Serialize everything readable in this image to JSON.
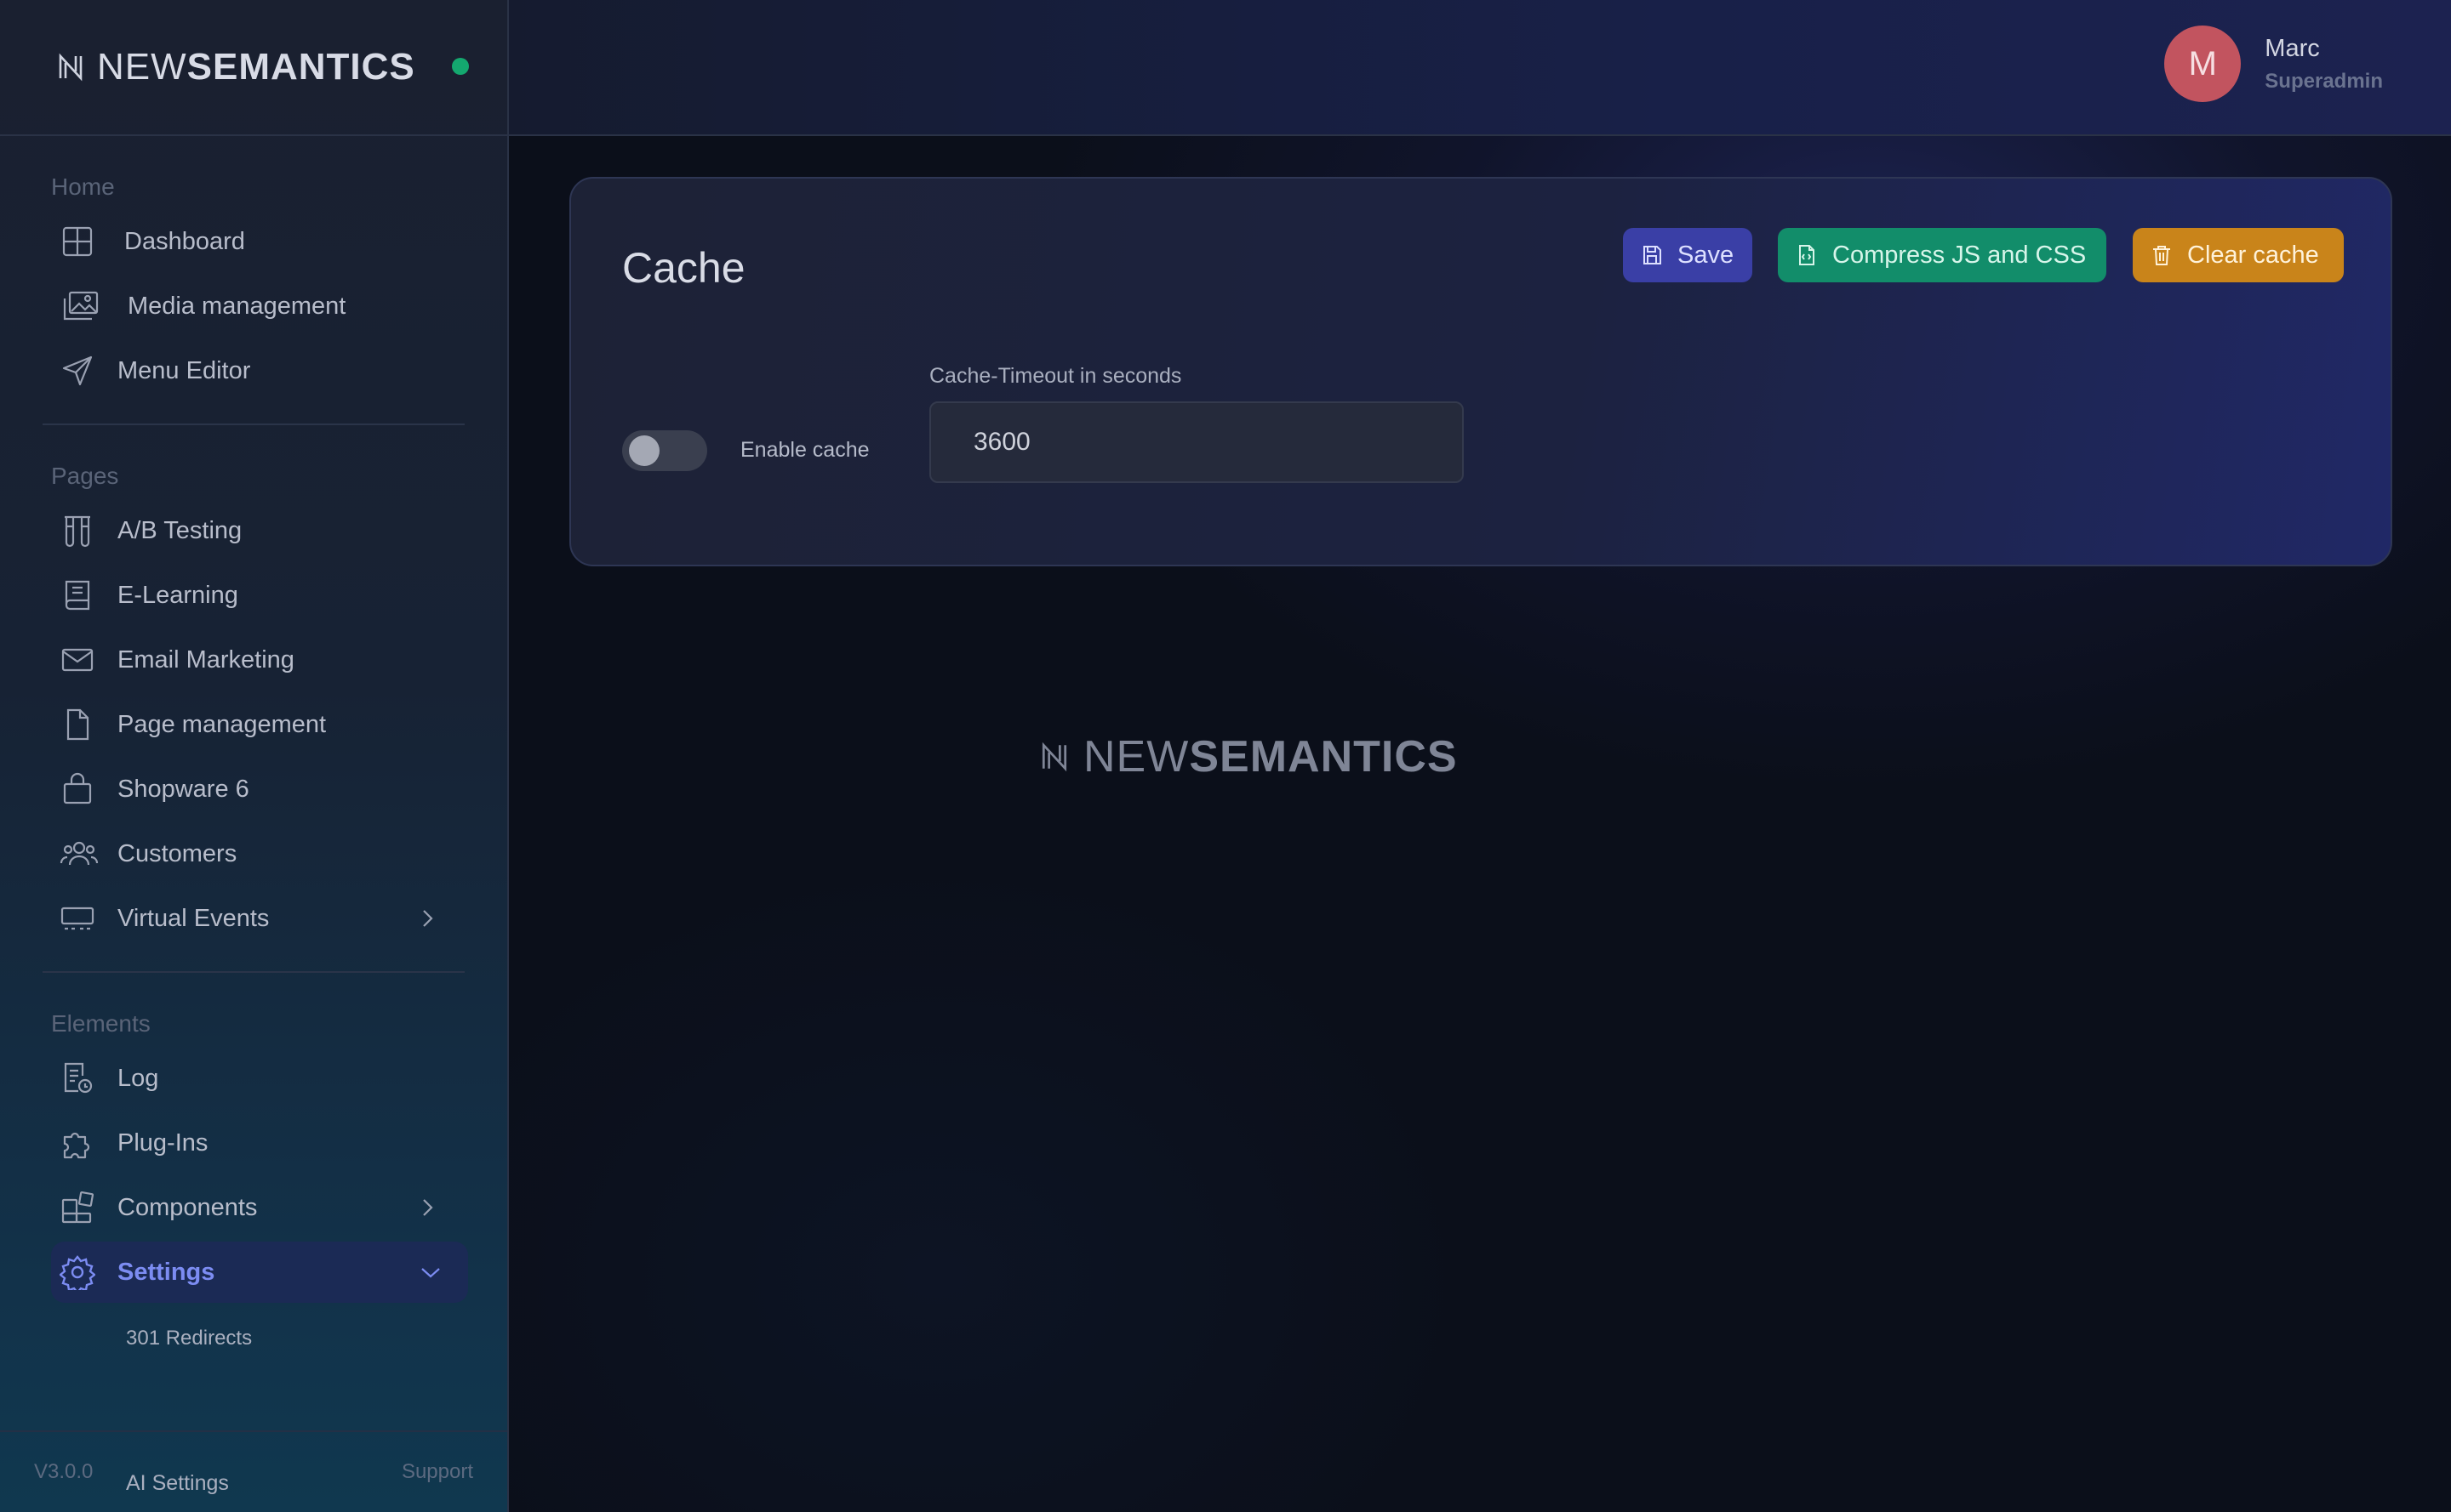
{
  "app": {
    "logo_prefix": "NEW",
    "logo_suffix": "SEMANTICS",
    "status_color": "#14a86f",
    "version": "V3.0.0",
    "support_label": "Support"
  },
  "user": {
    "initial": "M",
    "name": "Marc",
    "role": "Superadmin",
    "avatar_color": "#c2545f"
  },
  "sidebar": {
    "sections": [
      {
        "label": "Home",
        "items": [
          {
            "label": "Dashboard",
            "icon": "grid-icon"
          },
          {
            "label": "Media management",
            "icon": "images-icon"
          },
          {
            "label": "Menu Editor",
            "icon": "send-icon"
          }
        ]
      },
      {
        "label": "Pages",
        "items": [
          {
            "label": "A/B Testing",
            "icon": "beakers-icon"
          },
          {
            "label": "E-Learning",
            "icon": "book-icon"
          },
          {
            "label": "Email Marketing",
            "icon": "mail-icon"
          },
          {
            "label": "Page management",
            "icon": "file-icon"
          },
          {
            "label": "Shopware 6",
            "icon": "shopping-bag-icon"
          },
          {
            "label": "Customers",
            "icon": "users-icon"
          },
          {
            "label": "Virtual Events",
            "icon": "monitor-icon"
          }
        ]
      },
      {
        "label": "Elements",
        "items": [
          {
            "label": "Log",
            "icon": "log-icon"
          },
          {
            "label": "Plug-Ins",
            "icon": "puzzle-icon"
          },
          {
            "label": "Components",
            "icon": "components-icon"
          },
          {
            "label": "Settings",
            "icon": "gear-icon"
          }
        ]
      }
    ],
    "settings_subitems": [
      "301 Redirects",
      "AI Settings"
    ]
  },
  "main": {
    "card_title": "Cache",
    "buttons": {
      "save": "Save",
      "compress": "Compress JS and CSS",
      "clear": "Clear cache"
    },
    "toggle": {
      "label": "Enable cache",
      "enabled": false
    },
    "timeout": {
      "label": "Cache-Timeout in seconds",
      "value": "3600"
    }
  },
  "colors": {
    "save_button": "#3a3fa6",
    "compress_button": "#128d6a",
    "clear_button": "#c9841a",
    "active_nav": "#7c8cf2"
  }
}
